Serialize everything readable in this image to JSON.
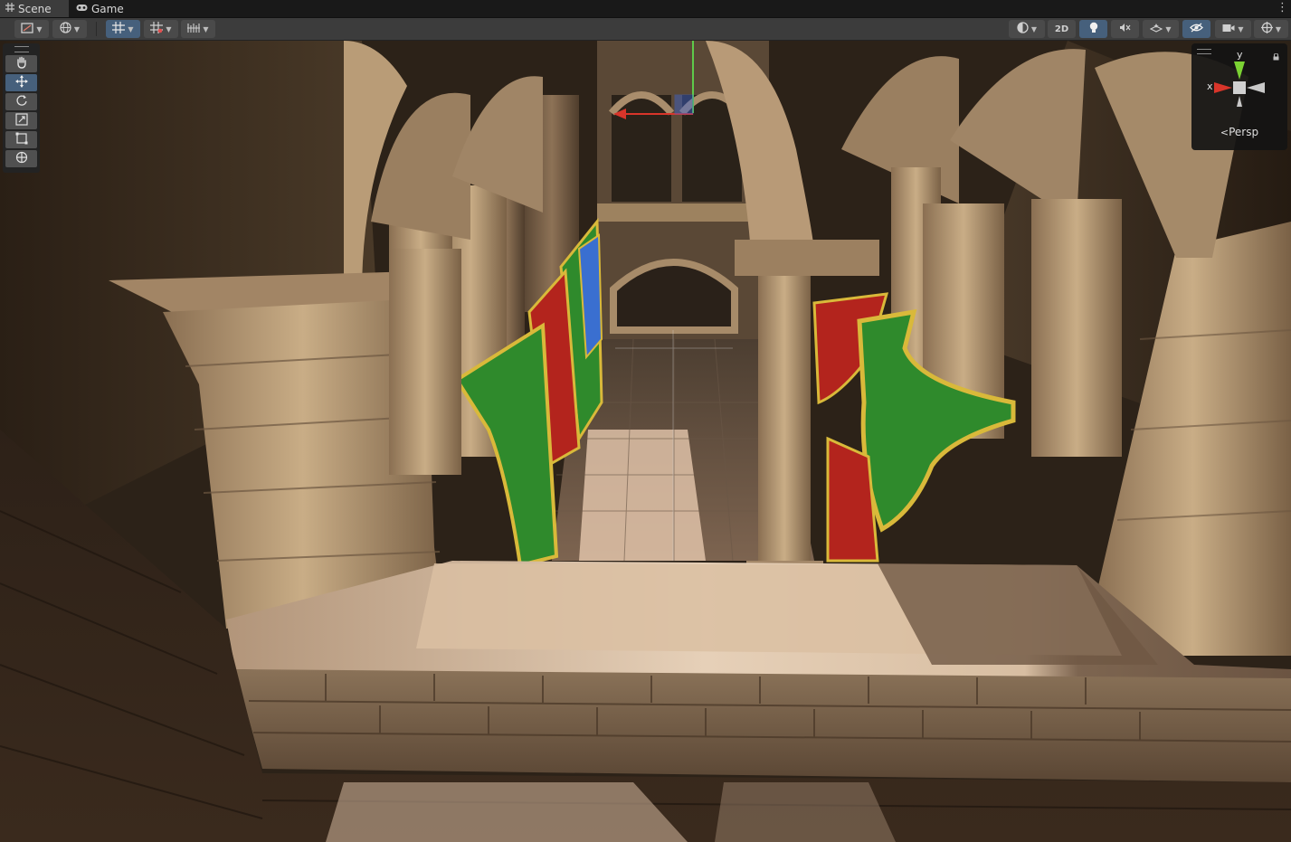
{
  "tabs": [
    {
      "label": "Scene",
      "icon": "grid-icon",
      "active": true
    },
    {
      "label": "Game",
      "icon": "gamepad-icon",
      "active": false
    }
  ],
  "toolbar": {
    "draw_mode": {
      "icon": "shading-mode-icon"
    },
    "global_local": {
      "icon": "globe-icon"
    },
    "grid_snapping": {
      "icon": "grid-snap-icon",
      "active": true
    },
    "grid_visibility": {
      "icon": "grid-visibility-icon"
    },
    "increment_snap": {
      "icon": "increment-snap-icon"
    },
    "shading": {
      "icon": "sphere-shading-icon"
    },
    "toggle_2d_label": "2D",
    "lighting": {
      "icon": "lightbulb-icon"
    },
    "audio": {
      "icon": "audio-mute-icon"
    },
    "effects": {
      "icon": "effects-icon"
    },
    "hidden_objects": {
      "icon": "visibility-icon"
    },
    "camera": {
      "icon": "camera-icon"
    },
    "gizmos": {
      "icon": "gizmos-icon"
    }
  },
  "tool_palette": [
    {
      "name": "hand",
      "icon": "hand-icon",
      "active": false
    },
    {
      "name": "move",
      "icon": "move-icon",
      "active": true
    },
    {
      "name": "rotate",
      "icon": "rotate-icon",
      "active": false
    },
    {
      "name": "scale",
      "icon": "scale-icon",
      "active": false
    },
    {
      "name": "rect",
      "icon": "rect-transform-icon",
      "active": false
    },
    {
      "name": "transform",
      "icon": "transform-icon",
      "active": false
    }
  ],
  "orientation_gizmo": {
    "y_label": "y",
    "x_label": "x",
    "projection_label": "Persp",
    "colors": {
      "x": "#d8352a",
      "y": "#7bd233",
      "z": "#3a63d4"
    }
  },
  "scene": {
    "description_icon": "sponza-scene-image",
    "colors": {
      "banner_red": "#b3241d",
      "banner_green": "#2f8a2c",
      "banner_trim": "#d9b93a",
      "stone": "#b89a72"
    }
  }
}
